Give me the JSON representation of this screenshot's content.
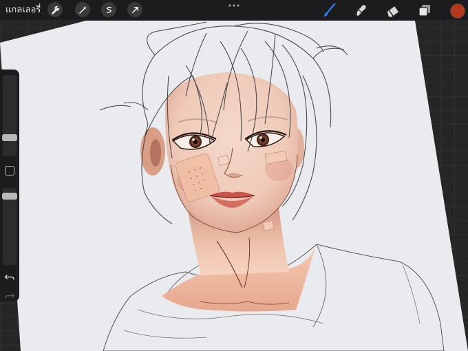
{
  "app": {
    "gallery_label": "แกลเลอรี่"
  },
  "toolbar": {
    "left_icons": [
      "wrench-icon",
      "magic-wand-icon",
      "selection-icon",
      "transform-arrow-icon"
    ],
    "more_icon": "ellipsis-icon",
    "right_tools": [
      "brush-icon",
      "smudge-icon",
      "eraser-icon",
      "layers-icon"
    ],
    "active_tool": "brush-icon"
  },
  "colors": {
    "accent": "#2f7cf6",
    "current_color": "#b5381d",
    "toolbar_bg": "#1c1c1e",
    "paper": "#e9ebee"
  },
  "sidebar": {
    "brush_size": 0.2,
    "opacity": 0.93
  }
}
